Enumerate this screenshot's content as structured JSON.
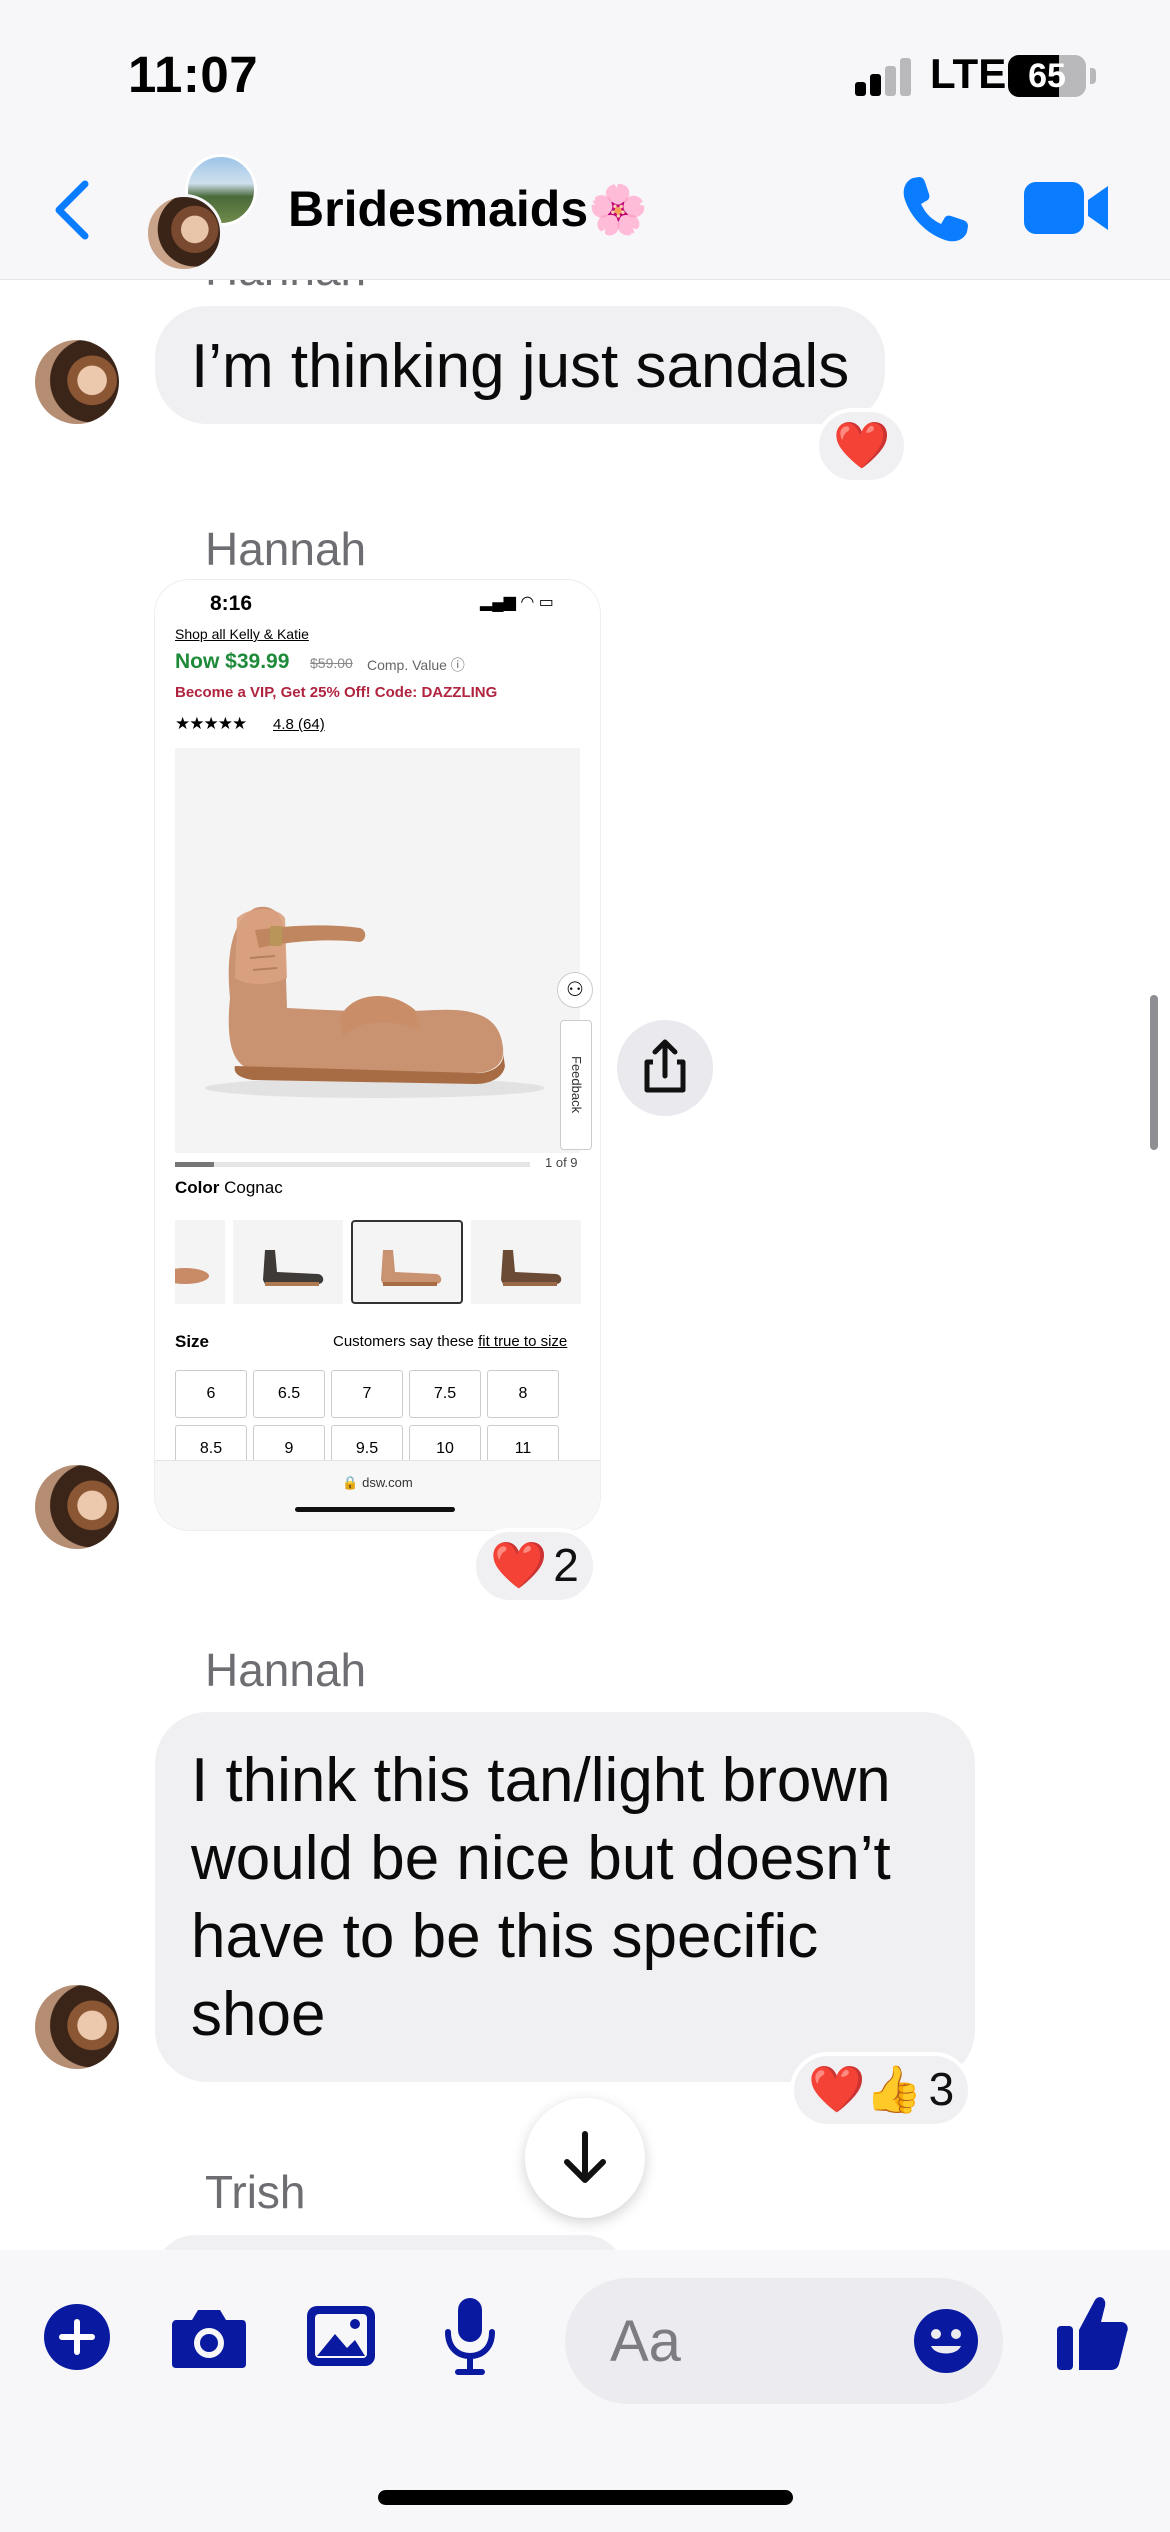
{
  "status_bar": {
    "time": "11:07",
    "network": "LTE",
    "battery": "65",
    "battery_level_percent": 65
  },
  "header": {
    "group_name": "Bridesmaids",
    "group_emoji": "🌸"
  },
  "messages": {
    "clipped_sender": "Hannah",
    "msg1": {
      "text": "I’m thinking just sandals",
      "reaction_emoji": "❤️"
    },
    "msg2": {
      "sender": "Hannah",
      "reaction_emoji": "❤️",
      "reaction_count": "2",
      "screenshot": {
        "time": "8:16",
        "link": "Shop all Kelly & Katie",
        "price": "Now $39.99",
        "old_price": "$59.00",
        "comp_value": "Comp. Value ⓘ",
        "promo": "Become a VIP, Get 25% Off! Code: DAZZLING",
        "stars": "★★★★★",
        "rating": "4.8 (64)",
        "feedback": "Feedback",
        "page_indicator": "1 of 9",
        "image_progress_fraction": 0.11,
        "color_label": "Color",
        "color_value": "Cognac",
        "size_title": "Size",
        "size_note_prefix": "Customers say these ",
        "size_note_link": "fit true to size",
        "sizes": [
          "6",
          "6.5",
          "7",
          "7.5",
          "8",
          "8.5",
          "9",
          "9.5",
          "10",
          "11"
        ],
        "url": "🔒 dsw.com"
      }
    },
    "msg3": {
      "sender": "Hannah",
      "text": "I think this tan/light brown would be nice but doesn’t have to be this specific shoe",
      "reaction_emoji": "❤️👍",
      "reaction_count": "3"
    },
    "msg4": {
      "sender": "Trish"
    }
  },
  "composer": {
    "placeholder": "Aa"
  },
  "colors": {
    "accent": "#0a7cff",
    "composer_icons": "#0a1aa0",
    "bubble": "#f0f0f3",
    "price_green": "#1f8a3a",
    "promo_red": "#b0243f"
  },
  "icons": [
    "back-chevron-icon",
    "phone-icon",
    "video-camera-icon",
    "share-icon",
    "arrow-down-icon",
    "plus-icon",
    "camera-icon",
    "gallery-icon",
    "microphone-icon",
    "emoji-icon",
    "thumbs-up-icon"
  ]
}
